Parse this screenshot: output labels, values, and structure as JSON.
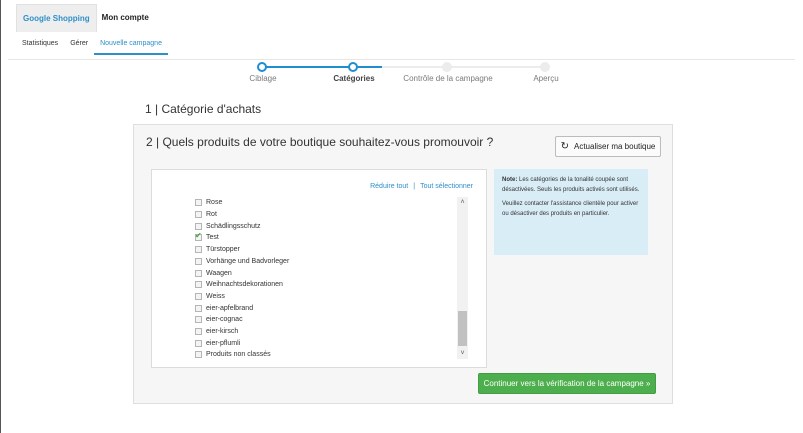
{
  "top_tabs": [
    {
      "label": "Google Shopping"
    },
    {
      "label": "Mon compte"
    }
  ],
  "sub_nav": [
    {
      "label": "Statistiques"
    },
    {
      "label": "Gérer"
    },
    {
      "label": "Nouvelle campagne"
    }
  ],
  "steps": [
    {
      "label": "Ciblage",
      "state": "done"
    },
    {
      "label": "Catégories",
      "state": "current"
    },
    {
      "label": "Contrôle de la campagne",
      "state": "todo"
    },
    {
      "label": "Aperçu",
      "state": "todo"
    }
  ],
  "section1": {
    "title": "1 | Catégorie d'achats"
  },
  "section2": {
    "title": "2 | Quels produits de votre boutique souhaitez-vous promouvoir ?",
    "refresh_label": "Actualiser ma boutique",
    "refresh_icon": "refresh-icon",
    "collapse_all": "Réduire tout",
    "separator": "|",
    "select_all": "Tout sélectionner",
    "categories": [
      {
        "label": "Rose",
        "checked": false
      },
      {
        "label": "Rot",
        "checked": false
      },
      {
        "label": "Schädlingsschutz",
        "checked": false
      },
      {
        "label": "Test",
        "checked": true
      },
      {
        "label": "Türstopper",
        "checked": false
      },
      {
        "label": "Vorhänge und Badvorleger",
        "checked": false
      },
      {
        "label": "Waagen",
        "checked": false
      },
      {
        "label": "Weihnachtsdekorationen",
        "checked": false
      },
      {
        "label": "Weiss",
        "checked": false
      },
      {
        "label": "eier-apfelbrand",
        "checked": false
      },
      {
        "label": "eier-cognac",
        "checked": false
      },
      {
        "label": "eier-kirsch",
        "checked": false
      },
      {
        "label": "eier-pflumli",
        "checked": false
      },
      {
        "label": "Produits non classés",
        "checked": false
      }
    ],
    "note": {
      "lead": "Note:",
      "text1": " Les catégories de la tonalité coupée sont désactivées. Seuls les produits activés sont utilisés.",
      "text2": "Veuillez contacter l'assistance clientèle pour activer ou désactiver des produits en particulier."
    },
    "continue_label": "Continuer vers la vérification de la campagne »"
  },
  "colors": {
    "accent": "#2e8fc9",
    "step_active": "#1e8ed1",
    "continue_bg": "#4cae4c",
    "note_bg": "#d9edf7"
  }
}
